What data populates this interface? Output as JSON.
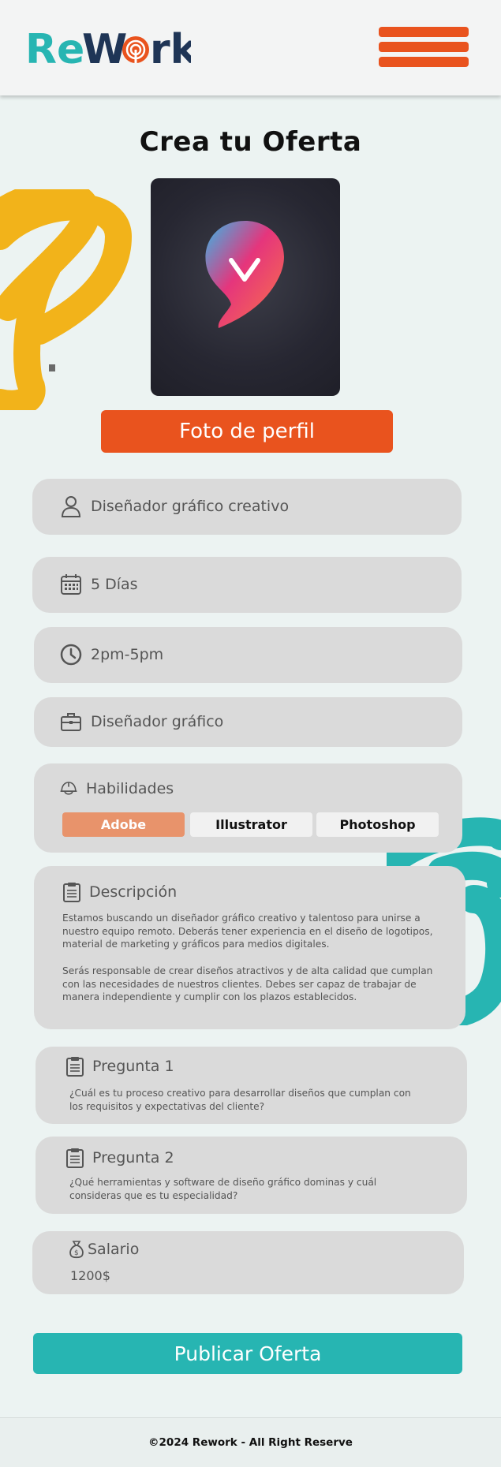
{
  "header": {
    "logo_text": "ReWork",
    "menu_icon": "hamburger-menu-icon"
  },
  "page": {
    "title": "Crea tu Oferta",
    "photo_button": "Foto de perfil"
  },
  "fields": {
    "title": {
      "icon": "user-icon",
      "value": "Diseñador gráfico creativo"
    },
    "duration": {
      "icon": "calendar-icon",
      "value": "5 Días"
    },
    "schedule": {
      "icon": "clock-icon",
      "value": "2pm-5pm"
    },
    "category": {
      "icon": "briefcase-icon",
      "value": "Diseñador gráfico"
    }
  },
  "skills": {
    "icon": "helmet-icon",
    "label": "Habilidades",
    "options": [
      {
        "label": "Adobe",
        "selected": true
      },
      {
        "label": "Illustrator",
        "selected": false
      },
      {
        "label": "Photoshop",
        "selected": false
      }
    ]
  },
  "description": {
    "icon": "clipboard-icon",
    "label": "Descripción",
    "paragraphs": [
      [
        "Estamos buscando un diseñador gráfico creativo y talentoso para unirse a",
        "nuestro equipo remoto. Deberás tener experiencia en el diseño de logotipos,",
        "material de marketing y gráficos para medios digitales."
      ],
      [
        "Serás responsable de crear diseños atractivos y de alta calidad que cumplan",
        "con las necesidades de nuestros clientes. Debes ser capaz de trabajar de",
        "manera independiente y cumplir con los plazos establecidos."
      ]
    ]
  },
  "questions": [
    {
      "icon": "clipboard-icon",
      "label": "Pregunta 1",
      "lines": [
        "¿Cuál es tu proceso creativo para desarrollar diseños que cumplan con",
        "los requisitos y expectativas del cliente?"
      ]
    },
    {
      "icon": "clipboard-icon",
      "label": "Pregunta 2",
      "lines": [
        "¿Qué herramientas y software de diseño gráfico dominas y cuál",
        "consideras que es tu especialidad?"
      ]
    }
  ],
  "salary": {
    "icon": "money-bag-icon",
    "label": "Salario",
    "value": "1200$"
  },
  "publish_button": "Publicar Oferta",
  "footer": {
    "text": "©2024 Rework - All Right Reserve"
  },
  "colors": {
    "brand_teal": "#27b5b2",
    "brand_orange": "#e9531e",
    "accent_yellow": "#f2b31a",
    "navy": "#1f3556",
    "card": "#dadada",
    "background": "#ecf3f2",
    "chip_active": "#e8936b"
  }
}
